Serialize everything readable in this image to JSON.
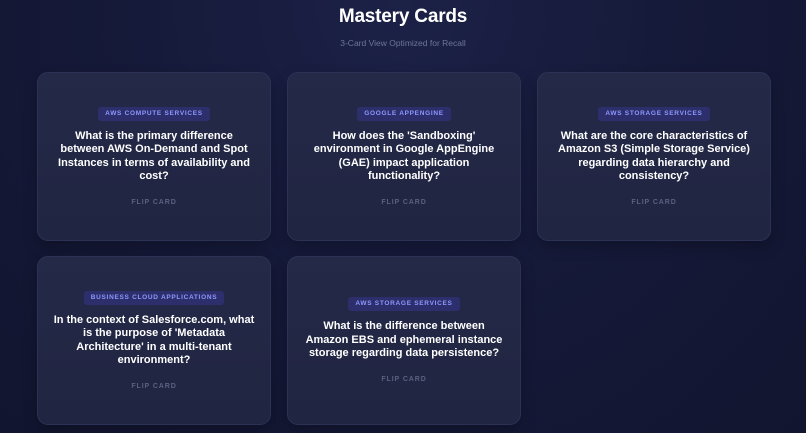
{
  "header": {
    "title": "Mastery Cards",
    "subtitle": "3-Card View Optimized for Recall"
  },
  "cards": [
    {
      "badge": "AWS COMPUTE SERVICES",
      "question": "What is the primary difference between AWS On-Demand and Spot Instances in terms of availability and cost?",
      "flip_label": "FLIP CARD"
    },
    {
      "badge": "GOOGLE APPENGINE",
      "question": "How does the 'Sandboxing' environment in Google AppEngine (GAE) impact application functionality?",
      "flip_label": "FLIP CARD"
    },
    {
      "badge": "AWS STORAGE SERVICES",
      "question": "What are the core characteristics of Amazon S3 (Simple Storage Service) regarding data hierarchy and consistency?",
      "flip_label": "FLIP CARD"
    },
    {
      "badge": "BUSINESS CLOUD APPLICATIONS",
      "question": "In the context of Salesforce.com, what is the purpose of 'Metadata Architecture' in a multi-tenant environment?",
      "flip_label": "FLIP CARD"
    },
    {
      "badge": "AWS STORAGE SERVICES",
      "question": "What is the difference between Amazon EBS and ephemeral instance storage regarding data persistence?",
      "flip_label": "FLIP CARD"
    }
  ]
}
